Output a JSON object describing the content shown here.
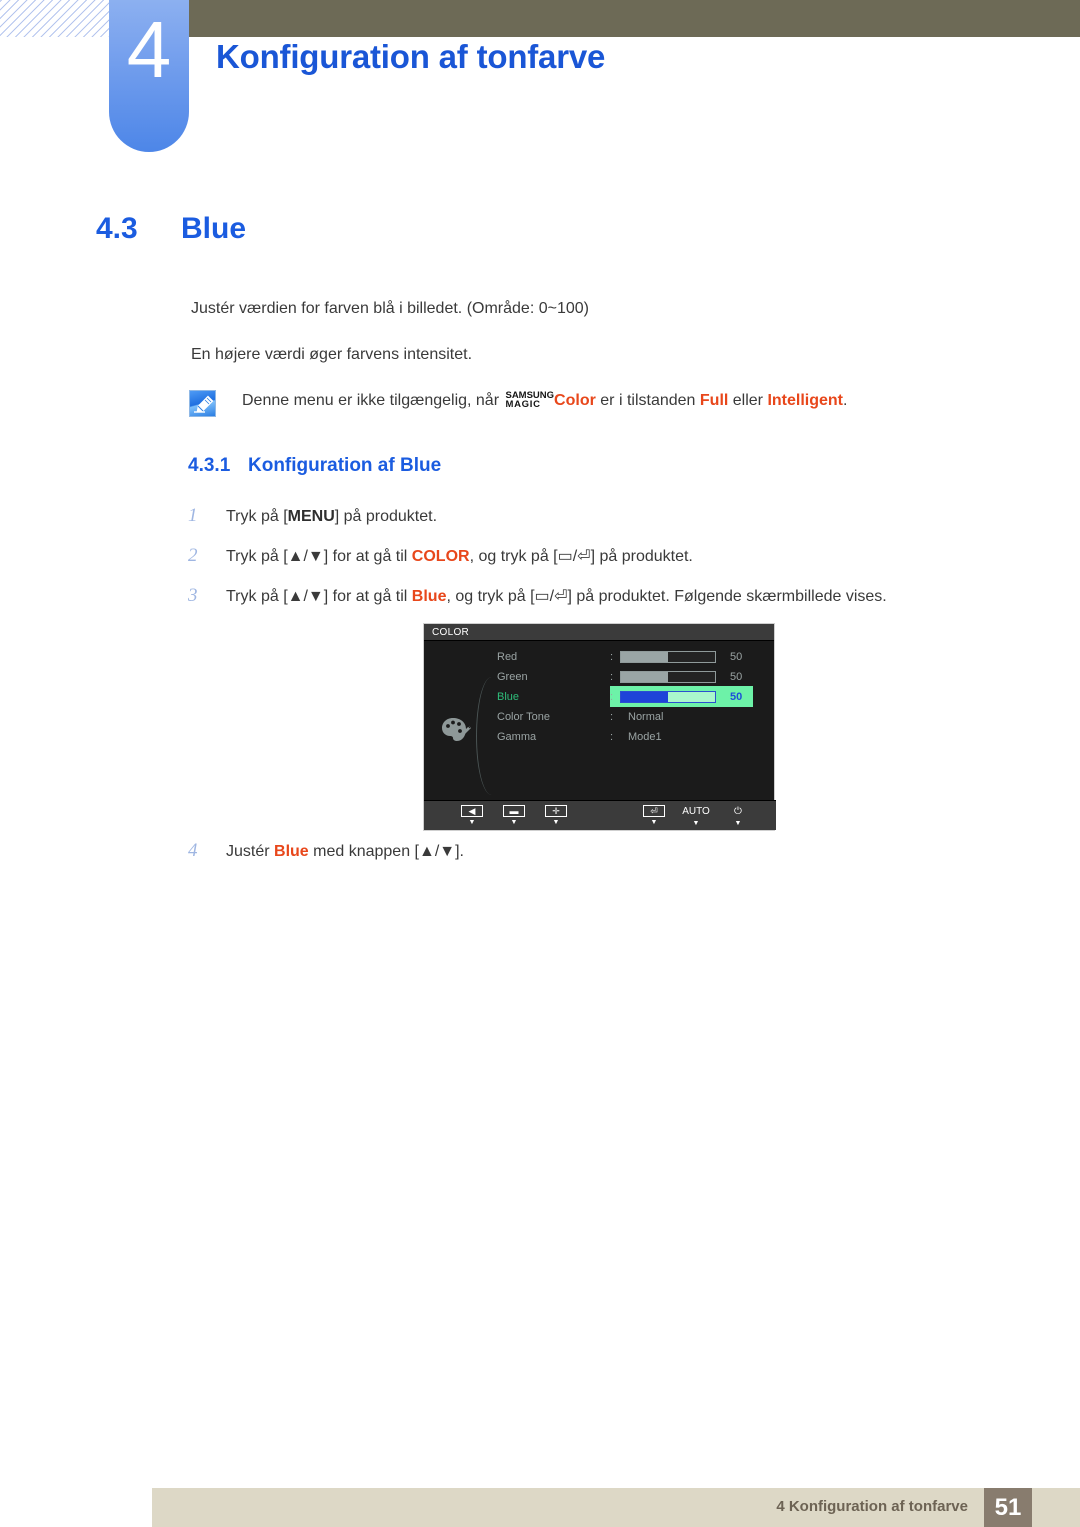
{
  "header": {
    "chapter_number": "4",
    "chapter_title": "Konfiguration af tonfarve"
  },
  "section": {
    "number": "4.3",
    "title": "Blue"
  },
  "body": {
    "paragraph_1": "Justér værdien for farven blå i billedet. (Område: 0~100)",
    "paragraph_2": "En højere værdi øger farvens intensitet."
  },
  "note": {
    "icon": "note-pen-icon",
    "text_before": "Denne menu er ikke tilgængelig, når ",
    "magic_line1": "SAMSUNG",
    "magic_line2": "MAGIC",
    "magic_color": "Color",
    "text_middle": " er i tilstanden ",
    "mode_full": "Full",
    "text_or": " eller ",
    "mode_intelligent": "Intelligent",
    "text_end": "."
  },
  "subsection": {
    "number": "4.3.1",
    "title": "Konfiguration af Blue"
  },
  "steps": [
    {
      "num": "1",
      "parts": [
        {
          "t": "Tryk på [",
          "s": "normal"
        },
        {
          "t": "MENU",
          "s": "bold"
        },
        {
          "t": "] på produktet.",
          "s": "normal"
        }
      ]
    },
    {
      "num": "2",
      "parts": [
        {
          "t": "Tryk på [▲/▼] for at gå til ",
          "s": "normal"
        },
        {
          "t": "COLOR",
          "s": "orange"
        },
        {
          "t": ", og tryk på [▭/⏎] på produktet.",
          "s": "normal"
        }
      ]
    },
    {
      "num": "3",
      "parts": [
        {
          "t": "Tryk på [▲/▼] for at gå til ",
          "s": "normal"
        },
        {
          "t": "Blue",
          "s": "orange"
        },
        {
          "t": ", og tryk på [▭/⏎] på produktet. Følgende skærmbillede vises.",
          "s": "normal"
        }
      ]
    }
  ],
  "step4": {
    "num": "4",
    "text_before": "Justér ",
    "highlight": "Blue",
    "text_after": " med knappen [▲/▼]."
  },
  "osd": {
    "title": "COLOR",
    "menu_icon": "color-palette-icon",
    "rows": [
      {
        "label": "Red",
        "colon": ":",
        "type": "slider",
        "value": "50",
        "fill_pct": 50,
        "highlighted": false
      },
      {
        "label": "Green",
        "colon": ":",
        "type": "slider",
        "value": "50",
        "fill_pct": 50,
        "highlighted": false
      },
      {
        "label": "Blue",
        "colon": ":",
        "type": "slider",
        "value": "50",
        "fill_pct": 50,
        "highlighted": true
      },
      {
        "label": "Color Tone",
        "colon": ":",
        "type": "text",
        "value": "Normal",
        "highlighted": false
      },
      {
        "label": "Gamma",
        "colon": ":",
        "type": "text",
        "value": "Mode1",
        "highlighted": false
      }
    ],
    "toolbar": [
      {
        "name": "back-icon",
        "glyph": "◀",
        "kind": "box",
        "caret": "▼"
      },
      {
        "name": "minus-icon",
        "glyph": "▬",
        "kind": "box",
        "caret": "▼"
      },
      {
        "name": "plus-icon",
        "glyph": "✛",
        "kind": "box",
        "caret": "▼"
      },
      {
        "name": "enter-icon",
        "glyph": "⏎",
        "kind": "box",
        "caret": "▼"
      },
      {
        "name": "auto-label",
        "glyph": "AUTO",
        "kind": "text",
        "caret": "▼"
      },
      {
        "name": "power-icon",
        "glyph": "⏻",
        "kind": "text",
        "caret": "▼"
      }
    ]
  },
  "footer": {
    "text": "4 Konfiguration af tonfarve",
    "page": "51"
  },
  "colors": {
    "heading_blue": "#1b5ce0",
    "accent_orange": "#e8471b",
    "olive_bar": "#6d6a56",
    "footer_bar": "#ddd8c6",
    "page_box": "#887c6e",
    "osd_highlight": "#6df2a8",
    "osd_slider_blue": "#1e44d8"
  }
}
